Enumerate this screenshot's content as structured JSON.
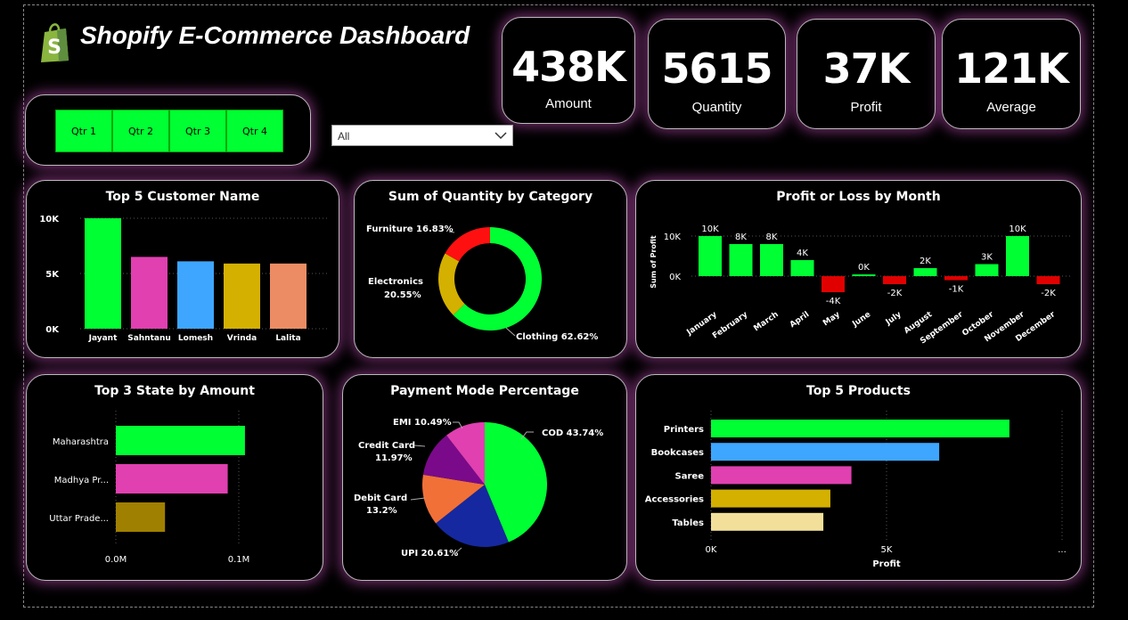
{
  "header": {
    "title": "Shopify E-Commerce Dashboard",
    "logo_icon": "shopify-bag-icon"
  },
  "kpis": [
    {
      "value": "438K",
      "label": "Amount"
    },
    {
      "value": "5615",
      "label": "Quantity"
    },
    {
      "value": "37K",
      "label": "Profit"
    },
    {
      "value": "121K",
      "label": "Average"
    }
  ],
  "filters": {
    "quarters": [
      "Qtr 1",
      "Qtr 2",
      "Qtr 3",
      "Qtr 4"
    ],
    "dropdown_value": "All",
    "dropdown_icon": "chevron-down-icon"
  },
  "colors": {
    "green": "#00ff33",
    "pink": "#e040b0",
    "blue": "#3ea6ff",
    "gold": "#d4b000",
    "salmon": "#ec8c64",
    "red": "#e00000"
  },
  "chart_data": [
    {
      "id": "top-customers",
      "type": "bar",
      "title": "Top 5 Customer Name",
      "categories": [
        "Jayant",
        "Sahntanu",
        "Lomesh",
        "Vrinda",
        "Lalita"
      ],
      "values": [
        10000,
        6500,
        6100,
        5900,
        5900
      ],
      "colors": [
        "#00ff33",
        "#e040b0",
        "#3ea6ff",
        "#d4b000",
        "#ec8c64"
      ],
      "yticks": [
        "0K",
        "5K",
        "10K"
      ],
      "ylim": [
        0,
        10000
      ]
    },
    {
      "id": "quantity-category",
      "type": "pie",
      "title": "Sum of Quantity by Category",
      "labels": [
        "Clothing",
        "Electronics",
        "Furniture"
      ],
      "values": [
        62.62,
        20.55,
        16.83
      ],
      "display": [
        "Clothing 62.62%",
        "Electronics",
        "20.55%",
        "Furniture 16.83%"
      ],
      "colors": [
        "#00ff33",
        "#d4b000",
        "#ff1010"
      ]
    },
    {
      "id": "profit-month",
      "type": "bar",
      "title": "Profit or Loss by Month",
      "ylabel": "Sum of Profit",
      "categories": [
        "January",
        "February",
        "March",
        "April",
        "May",
        "June",
        "July",
        "August",
        "September",
        "October",
        "November",
        "December"
      ],
      "values": [
        10000,
        8000,
        8000,
        4000,
        -4000,
        0,
        -2000,
        2000,
        -1000,
        3000,
        10000,
        -2000
      ],
      "data_labels": [
        "10K",
        "8K",
        "8K",
        "4K",
        "-4K",
        "0K",
        "-2K",
        "2K",
        "-1K",
        "3K",
        "10K",
        "-2K"
      ],
      "yticks": [
        "0K",
        "10K"
      ],
      "ylim": [
        -5000,
        11000
      ]
    },
    {
      "id": "top-states",
      "type": "bar",
      "title": "Top 3 State by Amount",
      "categories": [
        "Maharashtra",
        "Madhya Pr...",
        "Uttar Prade..."
      ],
      "values": [
        105000,
        91000,
        40000
      ],
      "colors": [
        "#00ff33",
        "#e040b0",
        "#a08000"
      ],
      "xticks": [
        "0.0M",
        "0.1M"
      ],
      "xlim": [
        0,
        100000
      ]
    },
    {
      "id": "payment-mode",
      "type": "pie",
      "title": "Payment Mode Percentage",
      "labels": [
        "COD",
        "UPI",
        "Debit Card",
        "Credit Card",
        "EMI"
      ],
      "values": [
        43.74,
        20.61,
        13.2,
        11.97,
        10.49
      ],
      "display": [
        "COD 43.74%",
        "UPI 20.61%",
        "Debit Card",
        "13.2%",
        "Credit Card",
        "11.97%",
        "EMI 10.49%"
      ],
      "colors": [
        "#00ff33",
        "#1528a0",
        "#f07038",
        "#7a0a8a",
        "#e040b0"
      ]
    },
    {
      "id": "top-products",
      "type": "bar",
      "title": "Top 5 Products",
      "xlabel": "Profit",
      "categories": [
        "Printers",
        "Bookcases",
        "Saree",
        "Accessories",
        "Tables"
      ],
      "values": [
        8500,
        6500,
        4000,
        3400,
        3200
      ],
      "colors": [
        "#00ff33",
        "#3ea6ff",
        "#e040b0",
        "#d4b000",
        "#f2e09a"
      ],
      "xticks": [
        "0K",
        "5K",
        "..."
      ],
      "xlim": [
        0,
        10000
      ]
    }
  ]
}
